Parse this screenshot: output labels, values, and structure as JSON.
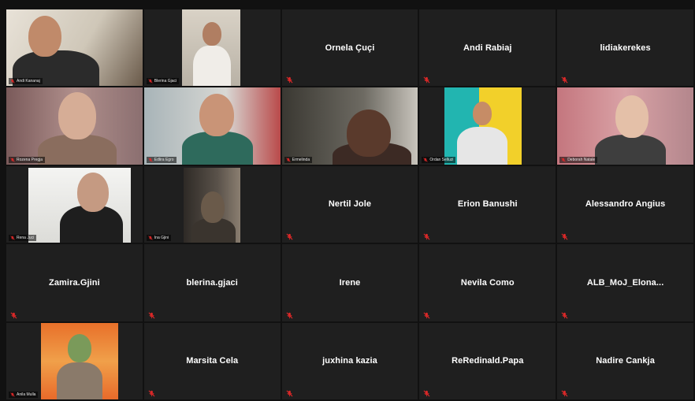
{
  "colors": {
    "mute_red": "#e02828",
    "tile_bg": "#1f1f1f"
  },
  "icons": {
    "muted": "microphone-muted-icon"
  },
  "participants": [
    {
      "name": "Andi Kananaj",
      "display": "video"
    },
    {
      "name": "Blerina Gjaci",
      "display": "video"
    },
    {
      "name": "Ornela Çuçi",
      "display": "name"
    },
    {
      "name": "Andi Rabiaj",
      "display": "name"
    },
    {
      "name": "lidiakerekes",
      "display": "name"
    },
    {
      "name": "Rozena Pregja",
      "display": "video"
    },
    {
      "name": "Edlira Egro",
      "display": "video"
    },
    {
      "name": "Ermelinda",
      "display": "video"
    },
    {
      "name": "Ordan Selluzi",
      "display": "video"
    },
    {
      "name": "Deborah Natale",
      "display": "video"
    },
    {
      "name": "Rena Juci",
      "display": "video"
    },
    {
      "name": "Ina Gjini",
      "display": "video"
    },
    {
      "name": "Nertil Jole",
      "display": "name"
    },
    {
      "name": "Erion Banushi",
      "display": "name"
    },
    {
      "name": "Alessandro Angius",
      "display": "name"
    },
    {
      "name": "Zamira.Gjini",
      "display": "name"
    },
    {
      "name": "blerina.gjaci",
      "display": "name"
    },
    {
      "name": "Irene",
      "display": "name"
    },
    {
      "name": "Nevila Como",
      "display": "name"
    },
    {
      "name": "ALB_MoJ_Elona...",
      "display": "name"
    },
    {
      "name": "Anila Mulla",
      "display": "video"
    },
    {
      "name": "Marsita Cela",
      "display": "name"
    },
    {
      "name": "juxhina kazia",
      "display": "name"
    },
    {
      "name": "ReRedinald.Papa",
      "display": "name"
    },
    {
      "name": "Nadire Cankja",
      "display": "name"
    }
  ]
}
